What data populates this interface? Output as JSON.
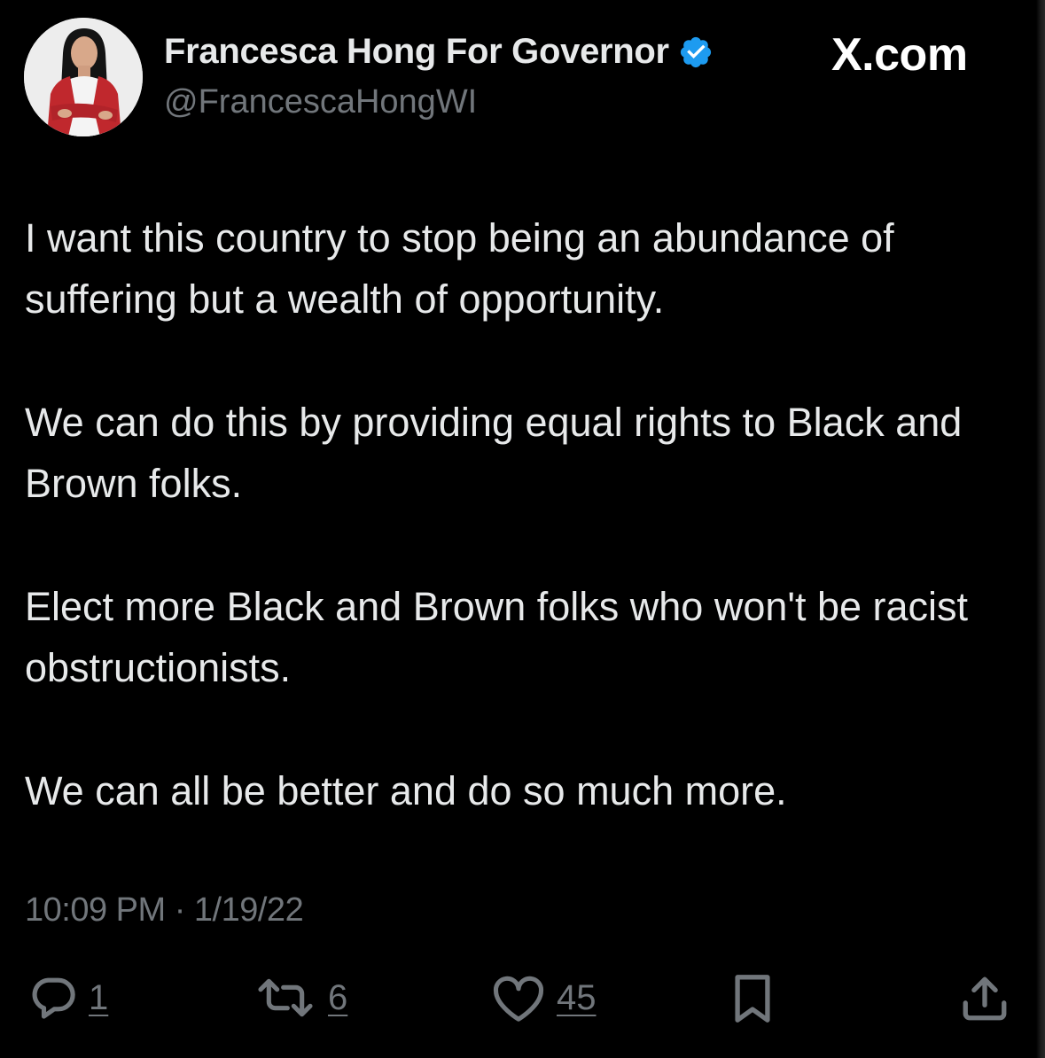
{
  "author": {
    "display_name": "Francesca Hong For Governor",
    "handle": "@FrancescaHongWI",
    "verified": true,
    "verified_color": "#1d9bf0"
  },
  "site": {
    "label": "X.com"
  },
  "tweet": {
    "paragraphs": [
      "I want this country to stop being an abundance of suffering but a wealth of opportunity.",
      "We can do this by providing equal rights to Black and Brown folks.",
      "Elect more Black and Brown folks who won't be racist obstructionists.",
      "We can all be better and do so much more."
    ],
    "timestamp": "10:09 PM · 1/19/22"
  },
  "actions": {
    "reply": {
      "icon": "reply-icon",
      "count": "1"
    },
    "retweet": {
      "icon": "retweet-icon",
      "count": "6"
    },
    "like": {
      "icon": "heart-icon",
      "count": "45"
    },
    "bookmark": {
      "icon": "bookmark-icon"
    },
    "share": {
      "icon": "share-icon"
    }
  },
  "colors": {
    "background": "#000000",
    "primary_text": "#e7e9ea",
    "secondary_text": "#71767b",
    "avatar_jacket": "#c0282d"
  }
}
